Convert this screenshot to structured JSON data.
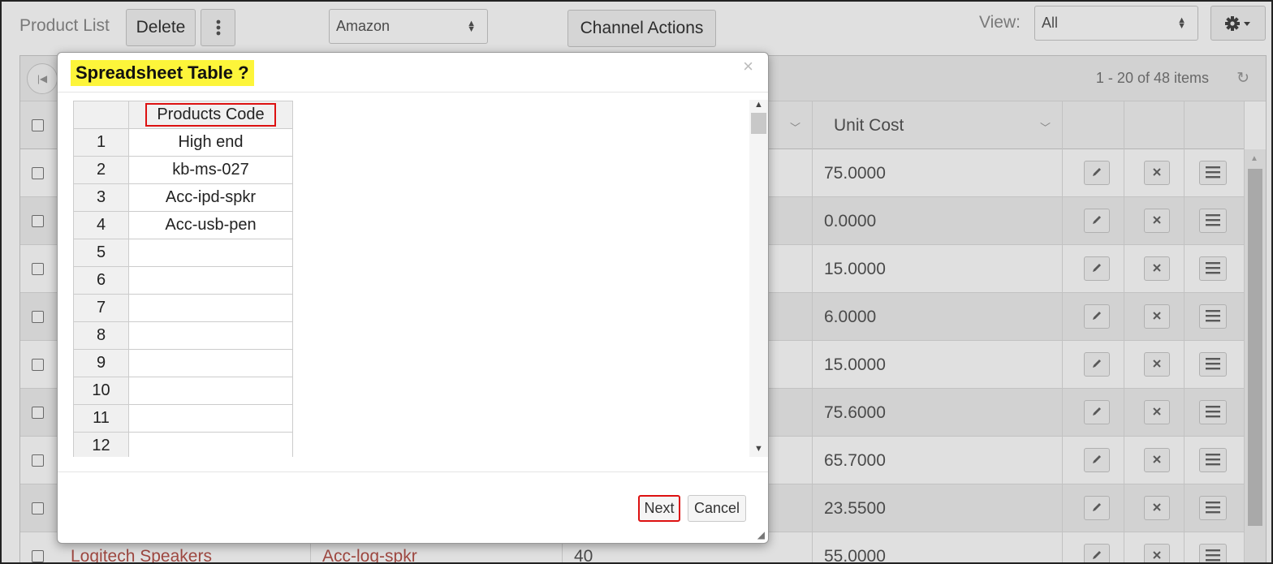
{
  "toolbar": {
    "title": "Product List",
    "delete_label": "Delete",
    "channel_value": "Amazon",
    "channel_actions_label": "Channel Actions",
    "view_label": "View:",
    "view_value": "All"
  },
  "pager": {
    "info": "1 - 20 of 48 items"
  },
  "grid": {
    "columns": {
      "unit_cost": "Unit Cost"
    },
    "rows": [
      {
        "unit_cost": "75.0000"
      },
      {
        "unit_cost": "0.0000"
      },
      {
        "unit_cost": "15.0000"
      },
      {
        "unit_cost": "6.0000"
      },
      {
        "unit_cost": "15.0000"
      },
      {
        "unit_cost": "75.6000"
      },
      {
        "unit_cost": "65.7000"
      },
      {
        "unit_cost": "23.5500"
      },
      {
        "name": "Logitech Speakers",
        "code": "Acc-log-spkr",
        "qty": "40",
        "unit_cost": "55.0000"
      }
    ]
  },
  "modal": {
    "title": "Spreadsheet Table ?",
    "column_header": "Products Code",
    "rows": [
      {
        "no": "1",
        "value": "High end"
      },
      {
        "no": "2",
        "value": "kb-ms-027"
      },
      {
        "no": "3",
        "value": "Acc-ipd-spkr"
      },
      {
        "no": "4",
        "value": "Acc-usb-pen"
      },
      {
        "no": "5",
        "value": ""
      },
      {
        "no": "6",
        "value": ""
      },
      {
        "no": "7",
        "value": ""
      },
      {
        "no": "8",
        "value": ""
      },
      {
        "no": "9",
        "value": ""
      },
      {
        "no": "10",
        "value": ""
      },
      {
        "no": "11",
        "value": ""
      },
      {
        "no": "12",
        "value": ""
      }
    ],
    "next_label": "Next",
    "cancel_label": "Cancel"
  }
}
